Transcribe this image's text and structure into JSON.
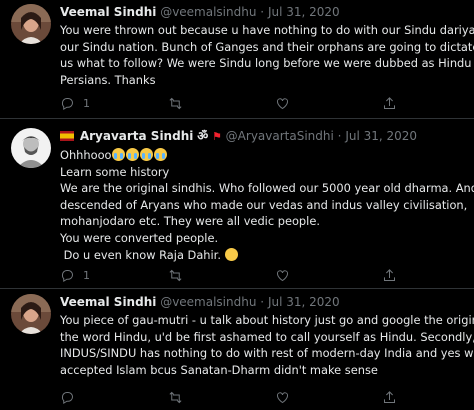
{
  "tweets": [
    {
      "name": "Veemal Sindhi",
      "handle": "@veemalsindhu",
      "sep": "·",
      "date": "Jul 31, 2020",
      "lines": [
        "You were thrown out because u have nothing to do with our Sindu dariyah",
        "our Sindu nation. Bunch of Ganges and their orphans are going to dictate",
        "us what to follow? We were Sindu long before we were dubbed as Hindu by",
        "Persians. Thanks"
      ],
      "reply_count": "1"
    },
    {
      "name": "Aryavarta Sindhi",
      "name_suffix": "ॐ",
      "handle": "@AryavartaSindhi",
      "sep": "·",
      "date": "Jul 31, 2020",
      "lines": [
        "Ohhhooo",
        "Learn some history",
        "We are the original sindhis. Who followed our 5000 year old dharma. And",
        "descended of Aryans who made our vedas and indus valley civilisation,",
        "mohanjodaro etc. They were all vedic people.",
        "You were converted people.",
        " Do u even know Raja Dahir."
      ],
      "reply_count": "1"
    },
    {
      "name": "Veemal Sindhi",
      "handle": "@veemalsindhu",
      "sep": "·",
      "date": "Jul 31, 2020",
      "lines": [
        "You piece of gau-mutri - u talk about history just go and google the origin of",
        "the word Hindu, u'd be first ashamed to call yourself as Hindu. Secondly,",
        "INDUS/SINDU has nothing to do with rest of modern-day India and yes we",
        "accepted Islam bcus Sanatan-Dharm didn't make sense"
      ]
    }
  ],
  "icons": [
    "reply-icon",
    "retweet-icon",
    "like-icon",
    "stats-icon",
    "share-icon"
  ],
  "colors": {
    "background": "#000000",
    "text": "#e7e9ea",
    "muted": "#71767b",
    "divider": "#2f3336"
  }
}
